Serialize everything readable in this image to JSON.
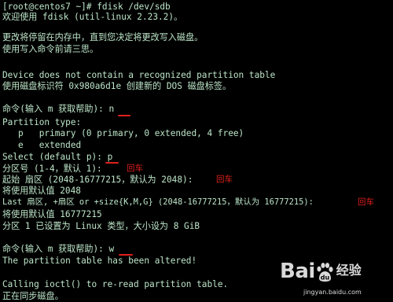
{
  "terminal": {
    "lines": [
      "[root@centos7 ~]# fdisk /dev/sdb",
      "欢迎使用 fdisk (util-linux 2.23.2)。",
      "",
      "更改将停留在内存中，直到您决定将更改写入磁盘。",
      "使用写入命令前请三思。",
      "",
      "",
      "Device does not contain a recognized partition table",
      "使用磁盘标识符 0x980a6d1e 创建新的 DOS 磁盘标签。",
      "",
      "命令(输入 m 获取帮助): n",
      "Partition type:",
      "   p   primary (0 primary, 0 extended, 4 free)",
      "   e   extended",
      "Select (default p): p",
      "分区号 (1-4，默认 1):",
      "起始 扇区 (2048-16777215，默认为 2048):",
      "将使用默认值 2048",
      "Last 扇区, +扇区 or +size{K,M,G} (2048-16777215，默认为 16777215):",
      "将使用默认值 16777215",
      "分区 1 已设置为 Linux 类型，大小设为 8 GiB",
      "",
      "命令(输入 m 获取帮助): w",
      "The partition table has been altered!",
      "",
      "Calling ioctl() to re-read partition table.",
      "正在同步磁盘。"
    ]
  },
  "annotations": {
    "enter_label": "回车"
  },
  "watermark": {
    "brand": "Bai",
    "brand_suffix": "经验",
    "url": "jingyan.baidu.com"
  },
  "colors": {
    "background": "#000000",
    "text": "#bde6c9",
    "annotation": "#e0201c"
  }
}
